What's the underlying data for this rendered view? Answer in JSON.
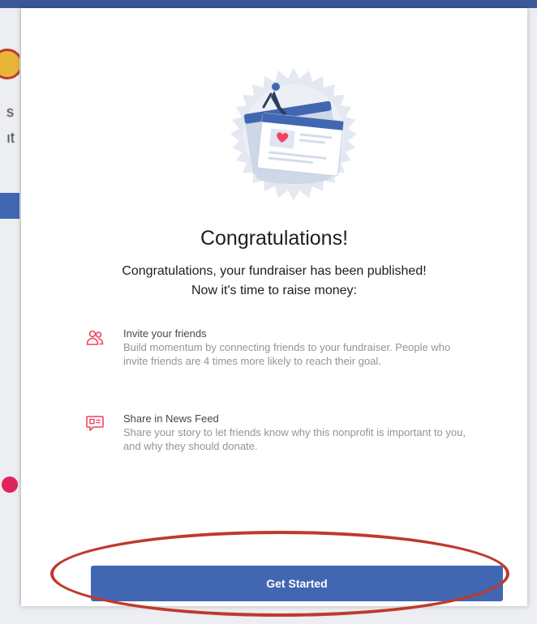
{
  "modal": {
    "title": "Congratulations!",
    "subtitle_line1": "Congratulations, your fundraiser has been published!",
    "subtitle_line2": "Now it's time to raise money:",
    "steps": [
      {
        "icon": "people-icon",
        "title": "Invite your friends",
        "description": "Build momentum by connecting friends to your fundraiser. People who invite friends are 4 times more likely to reach their goal."
      },
      {
        "icon": "news-feed-icon",
        "title": "Share in News Feed",
        "description": "Share your story to let friends know why this nonprofit is important to you, and why they should donate."
      }
    ],
    "cta_label": "Get Started"
  },
  "colors": {
    "accent": "#4267b2",
    "step_icon": "#f3425f",
    "highlight_ring": "#c0392b"
  }
}
